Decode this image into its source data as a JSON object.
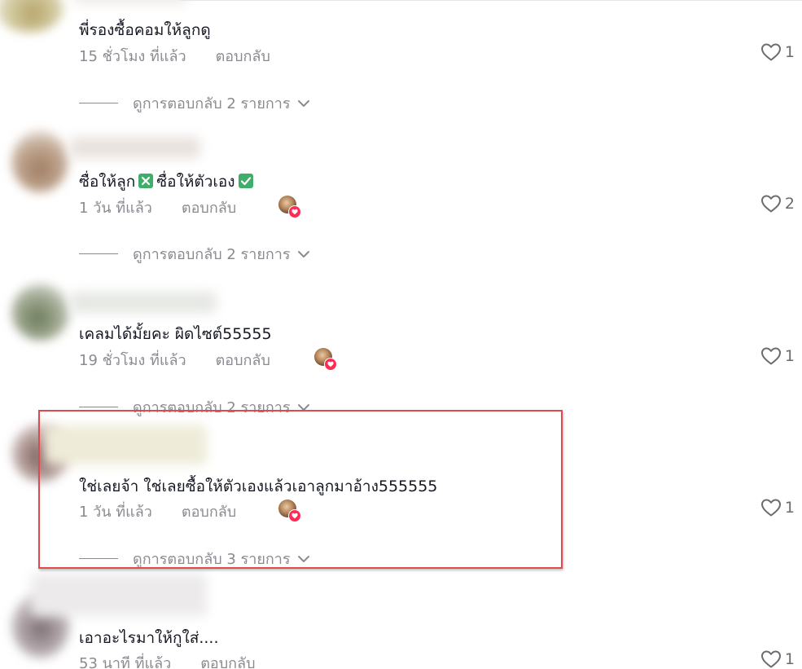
{
  "comments": [
    {
      "text": "พี่รองซื้อคอมให้ลูกดู",
      "time": "15 ชั่วโมง ที่แล้ว",
      "reply_label": "ตอบกลับ",
      "creator_liked": false,
      "likes": "1",
      "view_replies": "ดูการตอบกลับ 2 รายการ"
    },
    {
      "text_part1": "ซื่อให้ลูก",
      "text_part2": "ซื่อให้ตัวเอง",
      "emoji1": "cross-mark-box-icon",
      "emoji2": "check-mark-box-icon",
      "time": "1 วัน ที่แล้ว",
      "reply_label": "ตอบกลับ",
      "creator_liked": true,
      "likes": "2",
      "view_replies": "ดูการตอบกลับ 2 รายการ"
    },
    {
      "text": "เคลมได้มั้ยคะ ผิดไซต์55555",
      "time": "19 ชั่วโมง ที่แล้ว",
      "reply_label": "ตอบกลับ",
      "creator_liked": true,
      "likes": "1",
      "view_replies": "ดูการตอบกลับ 2 รายการ"
    },
    {
      "text": "ใช่เลยจ้า ใช่เลยซื้อให้ตัวเองแล้วเอาลูกมาอ้าง555555",
      "time": "1 วัน ที่แล้ว",
      "reply_label": "ตอบกลับ",
      "creator_liked": true,
      "likes": "1",
      "view_replies": "ดูการตอบกลับ 3 รายการ",
      "highlighted": true
    },
    {
      "text": "เอาอะไรมาให้กูใส่....",
      "time": "53 นาที ที่แล้ว",
      "reply_label": "ตอบกลับ",
      "creator_liked": false,
      "likes": "1"
    }
  ],
  "colors": {
    "text": "#161823",
    "meta": "#8a8b91",
    "heart_badge": "#fe2c55",
    "highlight": "#e0494d",
    "emoji_cross": "#3fae6a",
    "emoji_check": "#3fae6a"
  },
  "icons": {
    "like": "heart-outline-icon",
    "creator_like": "creator-heart-badge-icon",
    "expand": "chevron-down-icon"
  }
}
